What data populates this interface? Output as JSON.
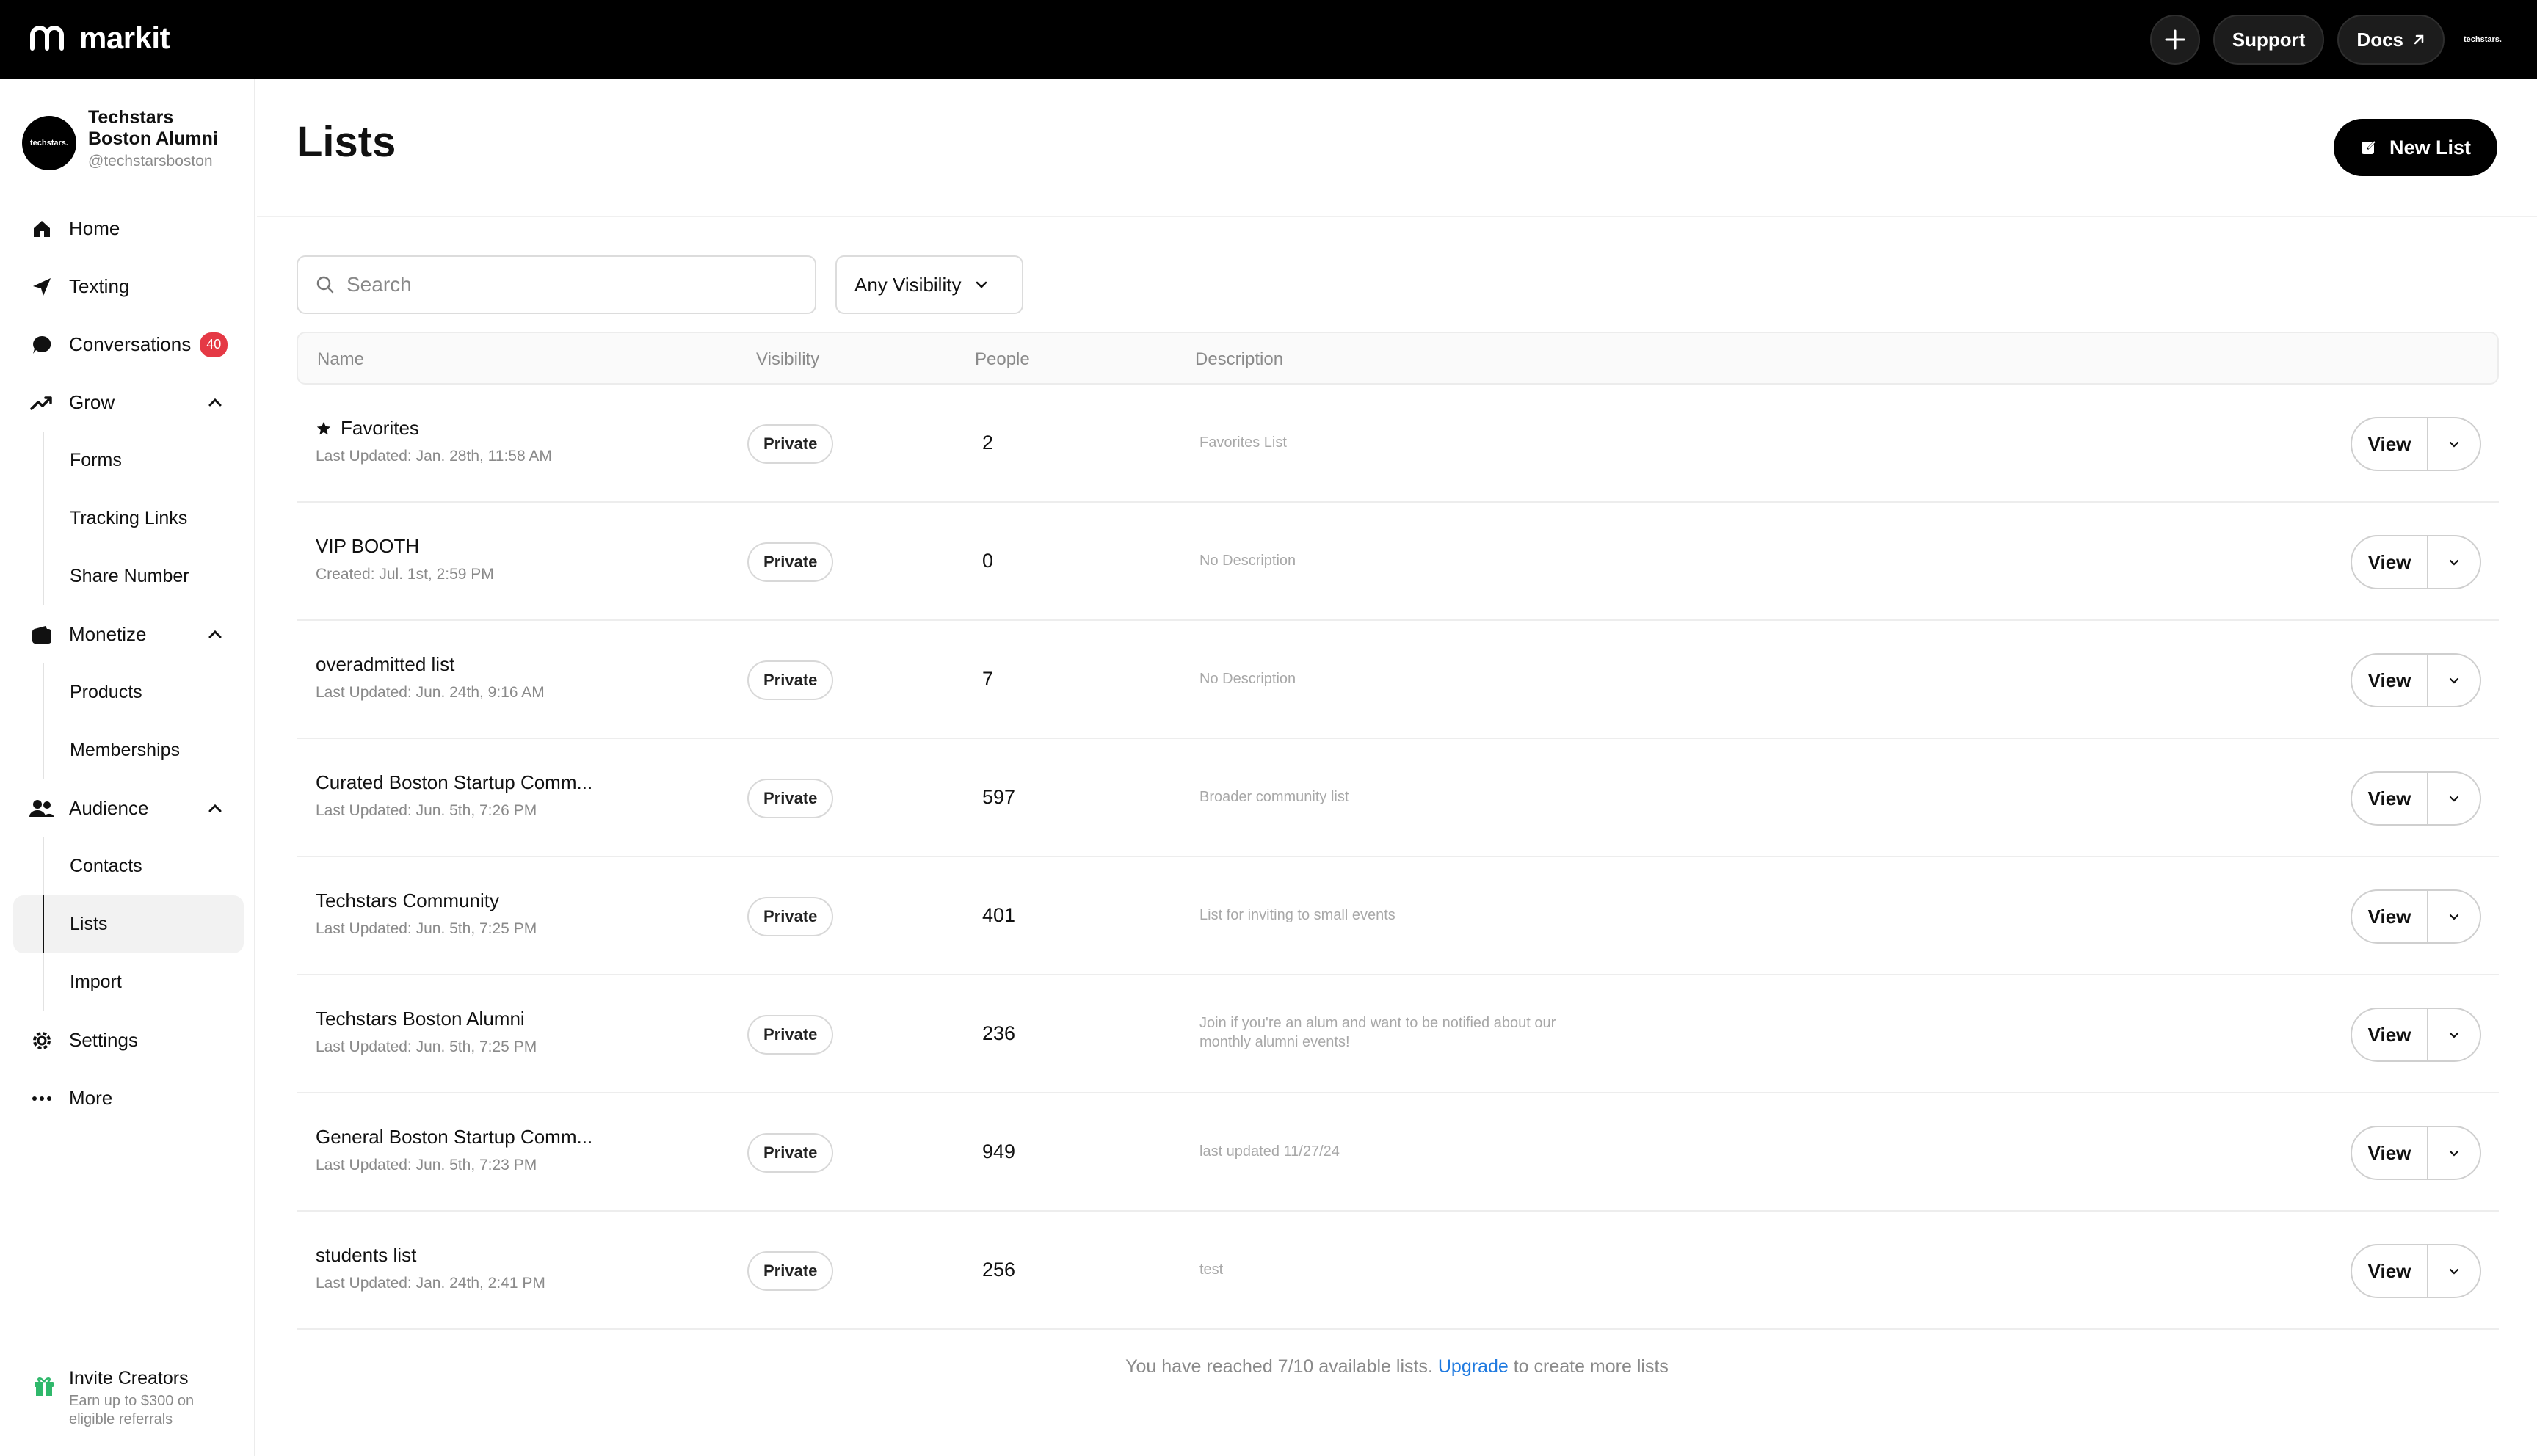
{
  "app": {
    "name": "markit"
  },
  "topbar": {
    "support_label": "Support",
    "docs_label": "Docs",
    "avatar_text": "techstars."
  },
  "account": {
    "name": "Techstars Boston Alumni",
    "handle": "@techstarsboston",
    "avatar_text": "techstars."
  },
  "nav": {
    "home": "Home",
    "texting": "Texting",
    "conversations": "Conversations",
    "conversations_badge": "40",
    "grow": "Grow",
    "forms": "Forms",
    "tracking_links": "Tracking Links",
    "share_number": "Share Number",
    "monetize": "Monetize",
    "products": "Products",
    "memberships": "Memberships",
    "audience": "Audience",
    "contacts": "Contacts",
    "lists": "Lists",
    "import": "Import",
    "settings": "Settings",
    "more": "More"
  },
  "invite": {
    "title": "Invite Creators",
    "subtitle": "Earn up to $300 on eligible referrals"
  },
  "page": {
    "title": "Lists",
    "new_list_label": "New List"
  },
  "filters": {
    "search_placeholder": "Search",
    "visibility_label": "Any Visibility"
  },
  "table": {
    "columns": [
      "Name",
      "Visibility",
      "People",
      "Description"
    ],
    "view_label": "View",
    "rows": [
      {
        "name": "Favorites",
        "starred": true,
        "meta": "Last Updated: Jan. 28th, 11:58 AM",
        "visibility": "Private",
        "people": "2",
        "description": "Favorites List"
      },
      {
        "name": "VIP BOOTH",
        "meta": "Created: Jul. 1st, 2:59 PM",
        "visibility": "Private",
        "people": "0",
        "description": "No Description"
      },
      {
        "name": "overadmitted list",
        "meta": "Last Updated: Jun. 24th, 9:16 AM",
        "visibility": "Private",
        "people": "7",
        "description": "No Description"
      },
      {
        "name": "Curated Boston Startup Comm...",
        "meta": "Last Updated: Jun. 5th, 7:26 PM",
        "visibility": "Private",
        "people": "597",
        "description": "Broader community list"
      },
      {
        "name": "Techstars Community",
        "meta": "Last Updated: Jun. 5th, 7:25 PM",
        "visibility": "Private",
        "people": "401",
        "description": "List for inviting to small events"
      },
      {
        "name": "Techstars Boston Alumni",
        "meta": "Last Updated: Jun. 5th, 7:25 PM",
        "visibility": "Private",
        "people": "236",
        "description": "Join if you're an alum and want to be notified about our monthly alumni events!"
      },
      {
        "name": "General Boston Startup Comm...",
        "meta": "Last Updated: Jun. 5th, 7:23 PM",
        "visibility": "Private",
        "people": "949",
        "description": "last updated 11/27/24"
      },
      {
        "name": "students list",
        "meta": "Last Updated: Jan. 24th, 2:41 PM",
        "visibility": "Private",
        "people": "256",
        "description": "test"
      }
    ]
  },
  "footer": {
    "prefix": "You have reached 7/10 available lists. ",
    "link": "Upgrade",
    "suffix": " to create more lists"
  },
  "colors": {
    "badge": "#e53945",
    "link": "#1f7ae0",
    "topbar": "#000000"
  }
}
